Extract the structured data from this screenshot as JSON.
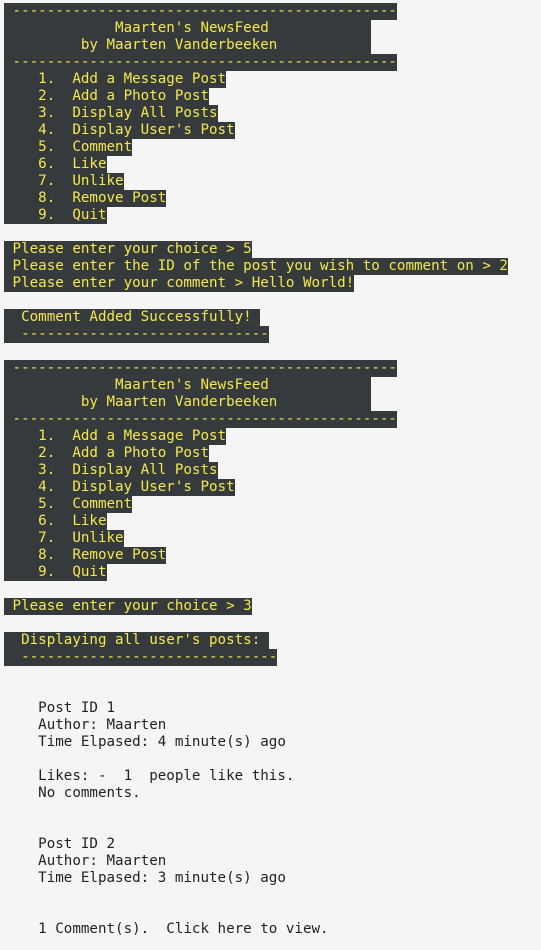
{
  "menu_blocks": [
    {
      "lines": [
        " ---------------------------------------------",
        "             Maarten's NewsFeed            ",
        "         by Maarten Vanderbeeken           ",
        " ---------------------------------------------",
        "    1.  Add a Message Post",
        "    2.  Add a Photo Post",
        "    3.  Display All Posts",
        "    4.  Display User's Post",
        "    5.  Comment",
        "    6.  Like",
        "    7.  Unlike",
        "    8.  Remove Post",
        "    9.  Quit"
      ]
    },
    {
      "lines": [
        " ---------------------------------------------",
        "             Maarten's NewsFeed            ",
        "         by Maarten Vanderbeeken           ",
        " ---------------------------------------------",
        "    1.  Add a Message Post",
        "    2.  Add a Photo Post",
        "    3.  Display All Posts",
        "    4.  Display User's Post",
        "    5.  Comment",
        "    6.  Like",
        "    7.  Unlike",
        "    8.  Remove Post",
        "    9.  Quit"
      ]
    }
  ],
  "prompts_first": [
    " Please enter your choice > 5",
    " Please enter the ID of the post you wish to comment on > 2",
    " Please enter your comment > Hello World!"
  ],
  "comment_result": [
    "  Comment Added Successfully! ",
    "  -----------------------------"
  ],
  "prompt_second": " Please enter your choice > 3",
  "display_header": [
    "  Displaying all user's posts: ",
    "  ------------------------------"
  ],
  "posts": [
    {
      "id_line": "    Post ID 1",
      "author_line": "    Author: Maarten",
      "time_line": "    Time Elpased: 4 minute(s) ago",
      "likes_line": "    Likes: -  1  people like this.",
      "comments_line": "    No comments."
    },
    {
      "id_line": "    Post ID 2",
      "author_line": "    Author: Maarten",
      "time_line": "    Time Elpased: 3 minute(s) ago",
      "comments_line": "    1 Comment(s).  Click here to view."
    }
  ]
}
